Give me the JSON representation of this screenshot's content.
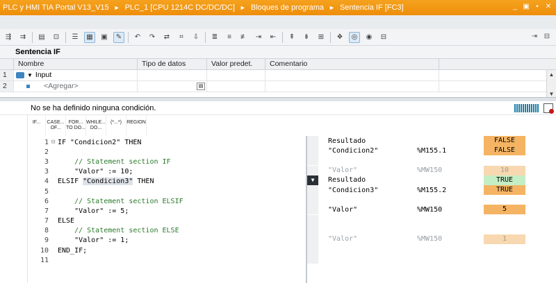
{
  "breadcrumb": [
    "PLC y HMI TIA Portal V13_V15",
    "PLC_1 [CPU 1214C DC/DC/DC]",
    "Bloques de programa",
    "Sentencia IF [FC3]"
  ],
  "window_controls": [
    "_",
    "▣",
    "▪",
    "✕"
  ],
  "colors": {
    "title_bar": "#f29612",
    "monitor_true_orange": "#f5b463",
    "monitor_green": "#c4efc4",
    "comment_green": "#2a7a2a"
  },
  "toolbar": {
    "icons": [
      "insert-row-icon",
      "add-row-icon",
      "block-interface-icon",
      "lock-icon",
      "list-icon",
      "table-view-icon",
      "load-icon",
      "edit-icon",
      "undo-icon",
      "redo-icon",
      "compare-icon",
      "network-icon",
      "insert-call-icon",
      "list-detail-icon",
      "comment-icon",
      "uncomment-icon",
      "indent-icon",
      "outdent-icon",
      "goto-icon",
      "monitor-icon",
      "expand-icon",
      "collapse-icon",
      "bookmark-icon",
      "breakpoint-icon",
      "monitoring-on-icon",
      "monitoring-off-icon",
      "watch-icon"
    ],
    "right_icons": [
      "arrow-icon",
      "settings-icon"
    ]
  },
  "interface": {
    "title": "Sentencia IF",
    "columns": [
      "Nombre",
      "Tipo de datos",
      "Valor predet.",
      "Comentario"
    ],
    "rows": [
      {
        "num": "1",
        "name": "Input"
      },
      {
        "num": "2",
        "name": "<Agregar>"
      }
    ]
  },
  "editor": {
    "status": "No se ha definido ninguna condición.",
    "instructions": [
      "IF...",
      "CASE... OF...",
      "FOR... TO DO...",
      "WHILE... DO...",
      "(*...*)",
      "REGION"
    ],
    "code_lines": [
      {
        "n": "1",
        "fold": "⊟",
        "parts": [
          {
            "t": "IF \"Condicion2\" THEN",
            "c": "code"
          }
        ]
      },
      {
        "n": "2",
        "fold": "",
        "parts": []
      },
      {
        "n": "3",
        "fold": "",
        "parts": [
          {
            "t": "    // Statement section IF",
            "c": "cmt"
          }
        ]
      },
      {
        "n": "3",
        "fold": "",
        "parts": [
          {
            "t": "    \"Valor\" := 10;",
            "c": "code"
          }
        ]
      },
      {
        "n": "4",
        "fold": "",
        "parts": [
          {
            "t": "ELSIF ",
            "c": "code"
          },
          {
            "t": "\"Condicion3\"",
            "c": "hl"
          },
          {
            "t": " THEN",
            "c": "code"
          }
        ]
      },
      {
        "n": "5",
        "fold": "",
        "parts": []
      },
      {
        "n": "6",
        "fold": "",
        "parts": [
          {
            "t": "    // Statement section ELSIF",
            "c": "cmt"
          }
        ]
      },
      {
        "n": "7",
        "fold": "",
        "parts": [
          {
            "t": "    \"Valor\" := 5;",
            "c": "code"
          }
        ]
      },
      {
        "n": "7",
        "fold": "",
        "parts": [
          {
            "t": "ELSE",
            "c": "code"
          }
        ]
      },
      {
        "n": "8",
        "fold": "",
        "parts": [
          {
            "t": "    // Statement section ELSE",
            "c": "cmt"
          }
        ]
      },
      {
        "n": "9",
        "fold": "",
        "parts": [
          {
            "t": "    \"Valor\" := 1;",
            "c": "code"
          }
        ]
      },
      {
        "n": "10",
        "fold": "",
        "parts": [
          {
            "t": "END_IF;",
            "c": "code"
          }
        ]
      },
      {
        "n": "11",
        "fold": "",
        "parts": []
      }
    ]
  },
  "monitor": {
    "rows": [
      {
        "gut": "",
        "name": "Resultado",
        "addr": "",
        "value": "FALSE",
        "style": "orange",
        "grey": false
      },
      {
        "gut": "",
        "name": "\"Condicion2\"",
        "addr": "%M155.1",
        "value": "FALSE",
        "style": "orange",
        "grey": false
      },
      {
        "gut": "",
        "name": "",
        "addr": "",
        "value": "",
        "style": "",
        "grey": false
      },
      {
        "gut": "",
        "name": "\"Valor\"",
        "addr": "%MW150",
        "value": "10",
        "style": "pale",
        "grey": true
      },
      {
        "gut": "on",
        "name": "Resultado",
        "addr": "",
        "value": "TRUE",
        "style": "green",
        "grey": false
      },
      {
        "gut": "",
        "name": "\"Condicion3\"",
        "addr": "%M155.2",
        "value": "TRUE",
        "style": "orange",
        "grey": false
      },
      {
        "gut": "",
        "name": "",
        "addr": "",
        "value": "",
        "style": "",
        "grey": false
      },
      {
        "gut": "",
        "name": "\"Valor\"",
        "addr": "%MW150",
        "value": "5",
        "style": "orange",
        "grey": false
      },
      {
        "gut": "",
        "name": "",
        "addr": "",
        "value": "",
        "style": "",
        "grey": false
      },
      {
        "gut": "",
        "name": "",
        "addr": "",
        "value": "",
        "style": "",
        "grey": false
      },
      {
        "gut": "",
        "name": "\"Valor\"",
        "addr": "%MW150",
        "value": "1",
        "style": "pale",
        "grey": true
      },
      {
        "gut": "",
        "name": "",
        "addr": "",
        "value": "",
        "style": "",
        "grey": false
      },
      {
        "gut": "",
        "name": "",
        "addr": "",
        "value": "",
        "style": "",
        "grey": false
      }
    ]
  }
}
